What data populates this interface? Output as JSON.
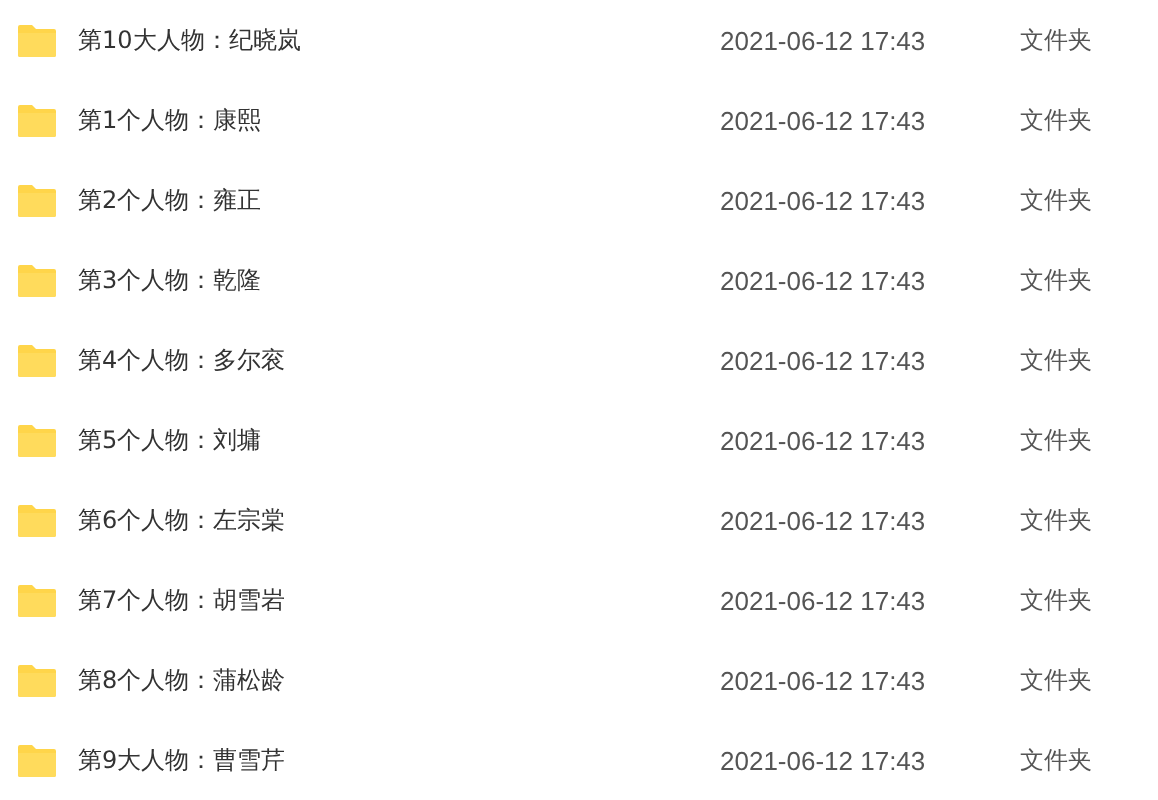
{
  "files": [
    {
      "name": "第10大人物：纪晓岚",
      "modified": "2021-06-12 17:43",
      "type": "文件夹"
    },
    {
      "name": "第1个人物：康熙",
      "modified": "2021-06-12 17:43",
      "type": "文件夹"
    },
    {
      "name": "第2个人物：雍正",
      "modified": "2021-06-12 17:43",
      "type": "文件夹"
    },
    {
      "name": "第3个人物：乾隆",
      "modified": "2021-06-12 17:43",
      "type": "文件夹"
    },
    {
      "name": "第4个人物：多尔衮",
      "modified": "2021-06-12 17:43",
      "type": "文件夹"
    },
    {
      "name": "第5个人物：刘墉",
      "modified": "2021-06-12 17:43",
      "type": "文件夹"
    },
    {
      "name": "第6个人物：左宗棠",
      "modified": "2021-06-12 17:43",
      "type": "文件夹"
    },
    {
      "name": "第7个人物：胡雪岩",
      "modified": "2021-06-12 17:43",
      "type": "文件夹"
    },
    {
      "name": "第8个人物：蒲松龄",
      "modified": "2021-06-12 17:43",
      "type": "文件夹"
    },
    {
      "name": "第9大人物：曹雪芹",
      "modified": "2021-06-12 17:43",
      "type": "文件夹"
    }
  ]
}
